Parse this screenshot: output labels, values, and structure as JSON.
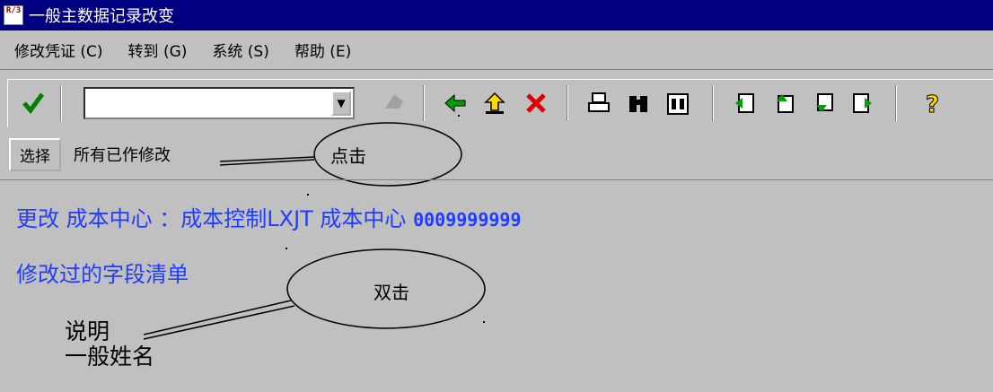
{
  "window": {
    "title": "一般主数据记录改变",
    "icon_text": "R/3"
  },
  "menu": [
    "修改凭证 (C)",
    "转到 (G)",
    "系统 (S)",
    "帮助 (E)"
  ],
  "toolbar": {
    "command_field_value": "",
    "icons": [
      "check-icon",
      "undo-icon",
      "back-arrow-icon",
      "exit-icon",
      "cancel-icon",
      "print-icon",
      "find-icon",
      "find-next-icon",
      "first-page-icon",
      "prev-page-icon",
      "next-page-icon",
      "last-page-icon",
      "help-icon"
    ]
  },
  "select_row": {
    "button_label": "选择",
    "text": "所有已作修改"
  },
  "annotations": {
    "click": "点击",
    "double_click": "双击"
  },
  "content": {
    "heading_prefix": "更改 成本中心 ：成本控制LXJT 成本中心",
    "cost_center_id": "0009999999",
    "list_title": "修改过的字段清单",
    "item1": "说明",
    "item2": "一般姓名"
  },
  "colors": {
    "titlebar": "#000080",
    "link_blue": "#1f3cff",
    "background": "#c0c0c0"
  }
}
